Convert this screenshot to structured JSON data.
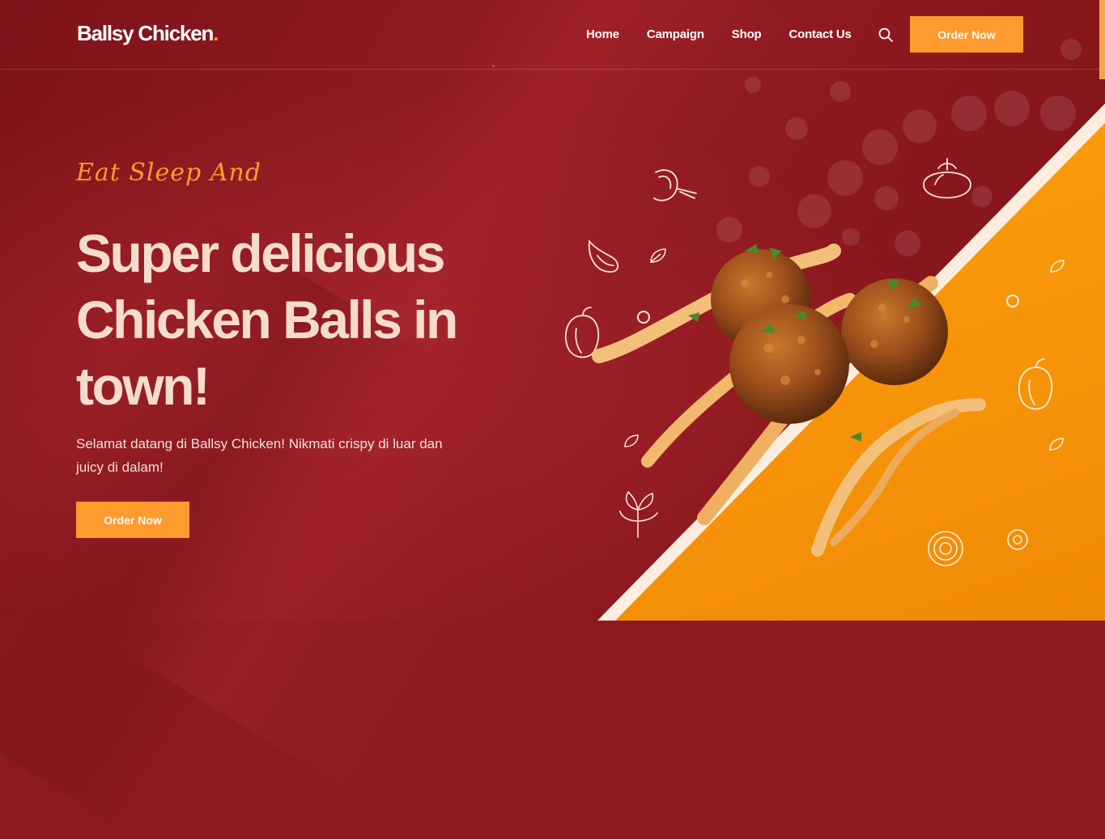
{
  "brand": {
    "name": "Ballsy Chicken",
    "dot": "."
  },
  "nav": {
    "items": [
      "Home",
      "Campaign",
      "Shop",
      "Contact Us"
    ]
  },
  "header": {
    "order_label": "Order Now",
    "search_icon": "search-icon"
  },
  "hero": {
    "tagline": "Eat Sleep And",
    "headline": "Super delicious Chicken Balls in town!",
    "description": "Selamat datang di Ballsy Chicken! Nikmati crispy di luar dan juicy di dalam!",
    "button_label": "Order Now"
  },
  "colors": {
    "accent": "#ff9a2e",
    "background": "#8e1a20",
    "diagonal": "#ffa619"
  }
}
